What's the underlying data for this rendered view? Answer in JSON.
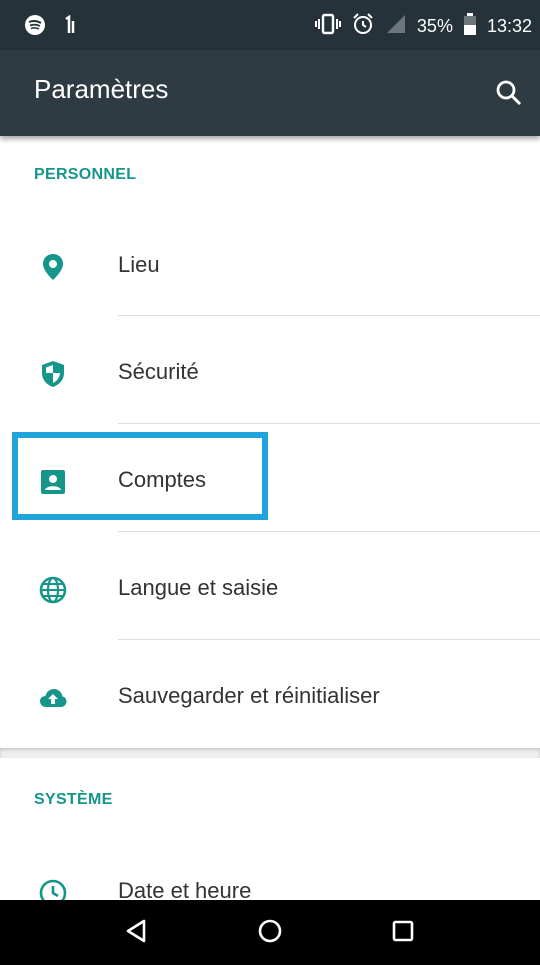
{
  "status_bar": {
    "battery": "35%",
    "time": "13:32",
    "icons": [
      "spotify-icon",
      "notification-icon",
      "vibrate-icon",
      "alarm-icon",
      "signal-icon",
      "battery-icon"
    ]
  },
  "app_bar": {
    "title": "Paramètres",
    "search_icon": "search-icon"
  },
  "sections": [
    {
      "header": "PERSONNEL",
      "items": [
        {
          "label": "Lieu",
          "icon": "location-icon"
        },
        {
          "label": "Sécurité",
          "icon": "shield-icon"
        },
        {
          "label": "Comptes",
          "icon": "account-icon",
          "highlighted": true
        },
        {
          "label": "Langue et saisie",
          "icon": "globe-icon"
        },
        {
          "label": "Sauvegarder et réinitialiser",
          "icon": "cloud-upload-icon"
        }
      ]
    },
    {
      "header": "SYSTÈME",
      "items": [
        {
          "label": "Date et heure",
          "icon": "clock-icon"
        }
      ]
    }
  ],
  "nav_bar": {
    "buttons": [
      "back-icon",
      "home-icon",
      "recents-icon"
    ]
  },
  "colors": {
    "status_bar": "#25323a",
    "app_bar": "#2e3b42",
    "accent": "#16968a",
    "highlight": "#1fa3dd"
  }
}
